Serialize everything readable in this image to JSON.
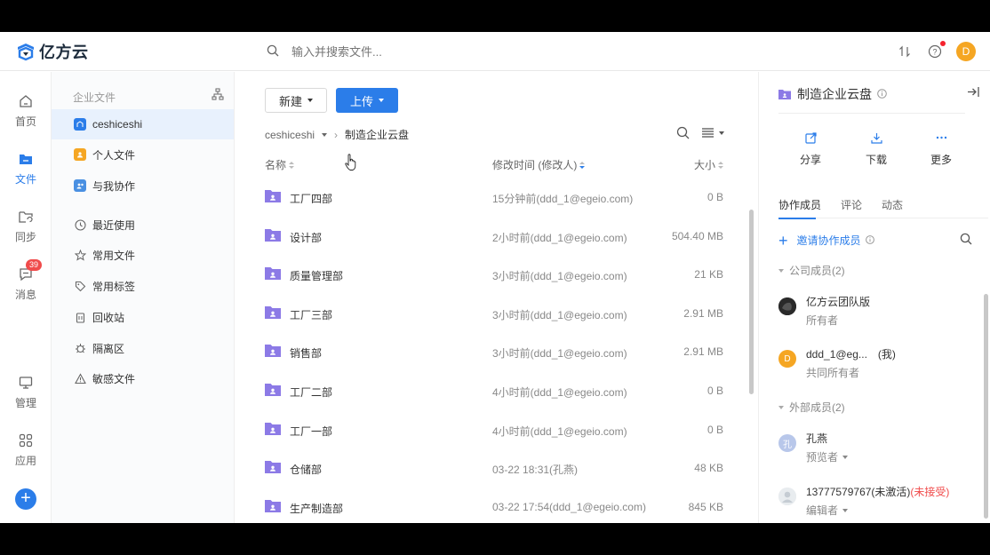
{
  "header": {
    "app_name": "亿方云",
    "search_placeholder": "输入并搜索文件...",
    "avatar_letter": "D"
  },
  "rail": [
    "首页",
    "文件",
    "同步",
    "消息",
    "管理",
    "应用"
  ],
  "rail_badge": "39",
  "nav": {
    "section_title": "企业文件",
    "items": [
      "ceshiceshi",
      "个人文件",
      "与我协作",
      "最近使用",
      "常用文件",
      "常用标签",
      "回收站",
      "隔离区",
      "敏感文件"
    ]
  },
  "toolbar": {
    "new_label": "新建",
    "upload_label": "上传"
  },
  "breadcrumb": {
    "root": "ceshiceshi",
    "current": "制造企业云盘"
  },
  "table": {
    "columns": [
      "名称",
      "修改时间 (修改人)",
      "大小"
    ],
    "rows": [
      {
        "name": "工厂四部",
        "modified": "15分钟前(ddd_1@egeio.com)",
        "size": "0 B"
      },
      {
        "name": "设计部",
        "modified": "2小时前(ddd_1@egeio.com)",
        "size": "504.40 MB"
      },
      {
        "name": "质量管理部",
        "modified": "3小时前(ddd_1@egeio.com)",
        "size": "21 KB"
      },
      {
        "name": "工厂三部",
        "modified": "3小时前(ddd_1@egeio.com)",
        "size": "2.91 MB"
      },
      {
        "name": "销售部",
        "modified": "3小时前(ddd_1@egeio.com)",
        "size": "2.91 MB"
      },
      {
        "name": "工厂二部",
        "modified": "4小时前(ddd_1@egeio.com)",
        "size": "0 B"
      },
      {
        "name": "工厂一部",
        "modified": "4小时前(ddd_1@egeio.com)",
        "size": "0 B"
      },
      {
        "name": "仓储部",
        "modified": "03-22 18:31(孔燕)",
        "size": "48 KB"
      },
      {
        "name": "生产制造部",
        "modified": "03-22 17:54(ddd_1@egeio.com)",
        "size": "845 KB"
      }
    ]
  },
  "detail": {
    "title": "制造企业云盘",
    "actions": [
      "分享",
      "下载",
      "更多"
    ],
    "tabs": [
      "协作成员",
      "评论",
      "动态"
    ],
    "invite_label": "邀请协作成员",
    "groups": [
      "公司成员(2)",
      "外部成员(2)"
    ],
    "members": [
      {
        "name": "亿方云团队版",
        "role": "所有者"
      },
      {
        "avatar": "D",
        "name": "ddd_1@eg...",
        "suffix": "(我)",
        "role": "共同所有者"
      },
      {
        "avatar": "孔",
        "name": "孔燕",
        "role": "预览者"
      },
      {
        "name": "13777579767(未激活)",
        "status": "(未接受)",
        "role": "编辑者"
      }
    ]
  },
  "colors": {
    "accent": "#2b7de9",
    "folder": "#8c7ae6",
    "alert": "#f04b4b"
  }
}
